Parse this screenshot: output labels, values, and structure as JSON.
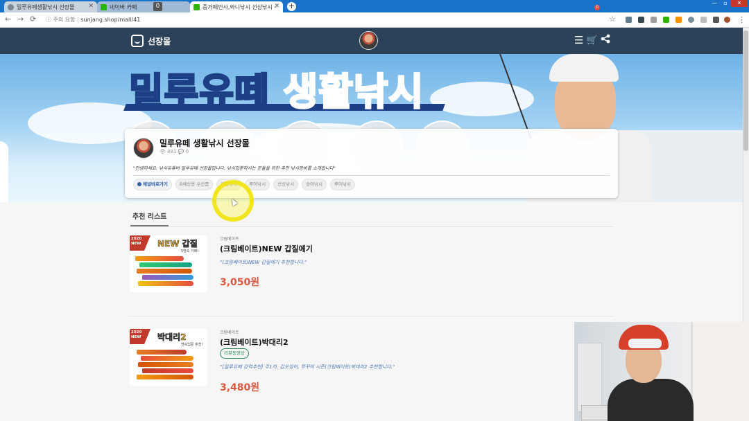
{
  "browser": {
    "tabs": [
      {
        "title": "밀루유떼생활낚시 선장몰",
        "active": false
      },
      {
        "title": "네이버 카페",
        "active": false,
        "badge": "0"
      },
      {
        "title": "증거떼인사,와니낚시 선상낚시 -",
        "active": true
      }
    ],
    "new_tab": "+",
    "security_label": "주의 요함",
    "url": "sunjang.shop/mall/41",
    "back": "←",
    "forward": "→",
    "reload": "⟳",
    "star": "☆"
  },
  "site": {
    "logo_text": "선장몰",
    "cart_count": "0",
    "banner_title_yellow": "밀루유떼",
    "banner_title_blue": "생활낚시",
    "store": {
      "name": "밀루유떼 생활낚시 선장몰",
      "views": "881",
      "comments": "0",
      "greeting": "\"안녕하세요. 낚시유튜버 밀루유떼 선장몰입니다. 낚시입문하시는 분들을 위한 추천 낚시장비를 소개합니다\"",
      "chips": [
        "채널바로가기",
        "B채상용 수산품",
        "생활낚시",
        "루어낚시",
        "선상낚시",
        "숭어낚시",
        "루어낚시"
      ]
    },
    "list_tab": "추천 리스트",
    "products": [
      {
        "brand": "크림베이트",
        "name": "(크림베이트)NEW 갑질에기",
        "description": "\"(크림베이트)NEW 갑질에기 추천합니다.\"",
        "price": "3,050원",
        "thumb_year": "2020",
        "thumb_new": "NEW",
        "thumb_head": "NEW 갑질",
        "thumb_sub": "5연속 거래!"
      },
      {
        "brand": "크림베이트",
        "name": "(크림베이트)박대리2",
        "tag": "리뷰동영상",
        "description": "\"[밀루유떼 강력추천] 주1끼, 갑오징어, 쭈꾸미 시즌(크림베이트)박대리2 추천합니다.\"",
        "price": "3,480원",
        "thumb_year": "2020",
        "thumb_new": "NEW",
        "thumb_head": "박대리2",
        "thumb_sub": "연속입문 추천!"
      }
    ]
  },
  "icons": [
    "back-arrow-icon",
    "forward-arrow-icon",
    "reload-icon",
    "info-icon",
    "star-icon",
    "menu-icon",
    "cart-icon",
    "share-icon",
    "eye-icon",
    "comment-icon",
    "heart-icon"
  ],
  "colors": {
    "tabbar": "#1a73c9",
    "site_header": "#2c4259",
    "price": "#d95940",
    "desc_blue": "#4a76b9",
    "banner_yellow": "#ffd21e",
    "highlight_yellow": "#f0e414"
  }
}
